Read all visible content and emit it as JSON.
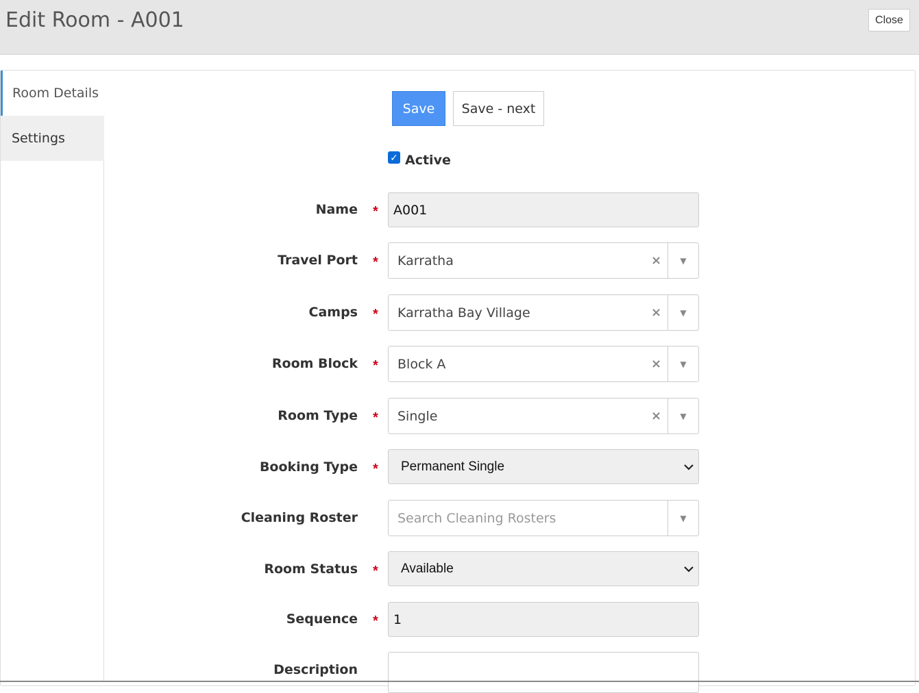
{
  "header": {
    "title": "Edit Room - A001",
    "close_label": "Close"
  },
  "sidebar": {
    "tabs": [
      {
        "label": "Room Details",
        "active": true
      },
      {
        "label": "Settings",
        "active": false
      }
    ]
  },
  "toolbar": {
    "save_label": "Save",
    "save_next_label": "Save - next"
  },
  "form": {
    "active": {
      "label": "Active",
      "checked": true
    },
    "required_marker": "*",
    "clear_glyph": "×",
    "name": {
      "label": "Name",
      "value": "A001"
    },
    "travel_port": {
      "label": "Travel Port",
      "value": "Karratha"
    },
    "camps": {
      "label": "Camps",
      "value": "Karratha Bay Village"
    },
    "room_block": {
      "label": "Room Block",
      "value": "Block A"
    },
    "room_type": {
      "label": "Room Type",
      "value": "Single"
    },
    "booking_type": {
      "label": "Booking Type",
      "value": "Permanent Single"
    },
    "cleaning_roster": {
      "label": "Cleaning Roster",
      "placeholder": "Search Cleaning Rosters"
    },
    "room_status": {
      "label": "Room Status",
      "value": "Available"
    },
    "sequence": {
      "label": "Sequence",
      "value": "1"
    },
    "description": {
      "label": "Description",
      "value": ""
    }
  },
  "icons": {
    "close": "close-icon",
    "dropdown": "triangle-down-icon",
    "chevron": "chevron-down-icon",
    "check": "checkmark-icon"
  },
  "colors": {
    "primary": "#4d94f5",
    "required": "#d0021b",
    "active_tab_accent": "#3e8ed0",
    "checkbox": "#0b6bd9",
    "header_bg": "#e6e6e6"
  }
}
